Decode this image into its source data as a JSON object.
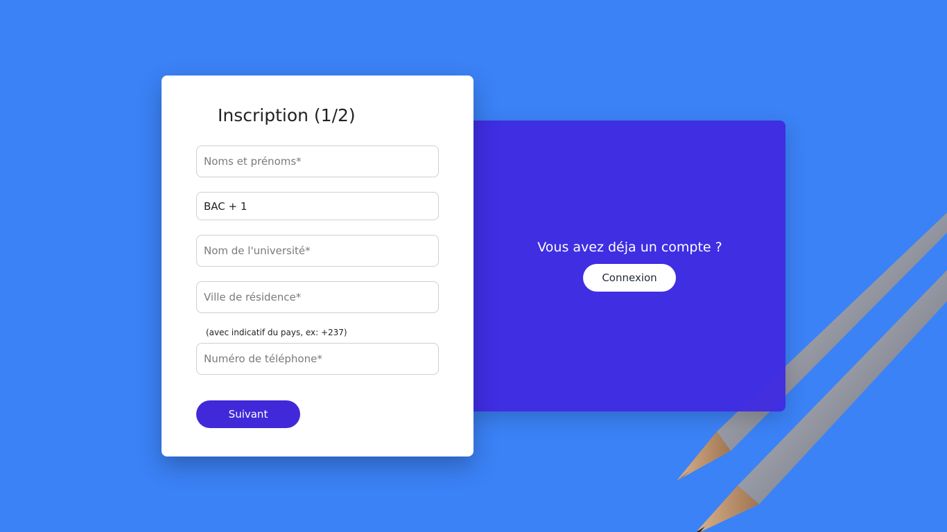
{
  "colors": {
    "background": "#3b82f6",
    "accent": "#4129d9",
    "card": "#ffffff"
  },
  "signup": {
    "title": "Inscription (1/2)",
    "fields": {
      "full_name_placeholder": "Noms et prénoms*",
      "level_value": "BAC + 1",
      "university_placeholder": "Nom de l'université*",
      "city_placeholder": "Ville de résidence*",
      "phone_hint": "(avec indicatif du pays, ex: +237)",
      "phone_placeholder": "Numéro de téléphone*"
    },
    "next_button": "Suivant"
  },
  "login_panel": {
    "title": "Vous avez déja un compte ?",
    "button": "Connexion"
  }
}
